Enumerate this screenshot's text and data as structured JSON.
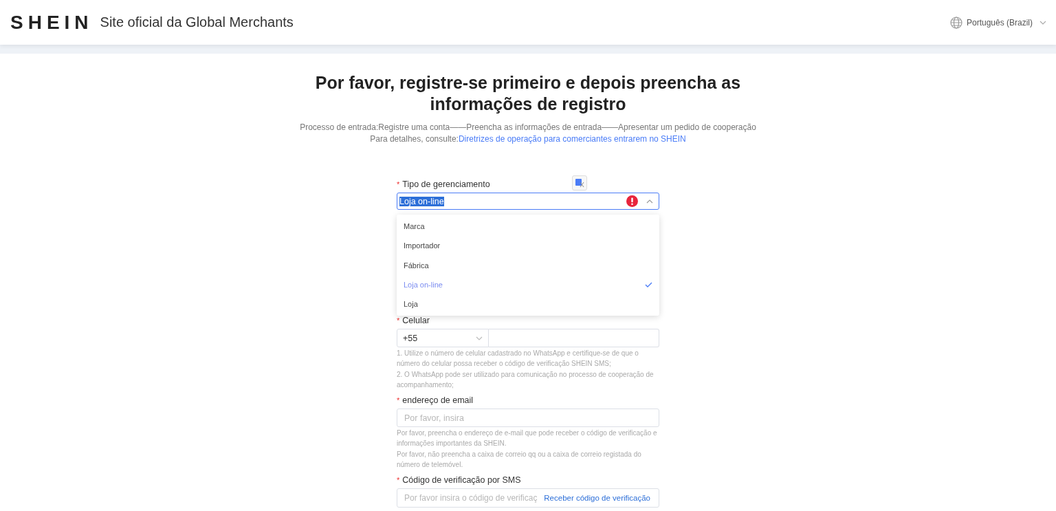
{
  "header": {
    "logo": "SHEIN",
    "subtitle": "Site oficial da Global Merchants",
    "language": "Português (Brazil)"
  },
  "intro": {
    "title": "Por favor, registre-se primeiro e depois preencha as informações de registro",
    "process": "Processo de entrada:Registre uma conta——Preencha as informações de entrada——Apresentar um pedido de cooperação",
    "details_prefix": "Para detalhes, consulte:",
    "details_link": "Diretrizes de operação para comerciantes entrarem no SHEIN"
  },
  "fields": [
    {
      "kind": "select",
      "label": "Tipo de gerenciamento",
      "marker": "*",
      "value": "Loja on-line",
      "error": true,
      "expanded": true,
      "options": [
        {
          "label": "Marca",
          "selected": false
        },
        {
          "label": "Importador",
          "selected": false
        },
        {
          "label": "Fábrica",
          "selected": false
        },
        {
          "label": "Loja on-line",
          "selected": true
        },
        {
          "label": "Loja",
          "selected": false
        }
      ]
    },
    {
      "kind": "phone",
      "label": "Celular",
      "marker": "*",
      "code": "+55",
      "hints": [
        "1. Utilize o número de celular cadastrado no WhatsApp e certifique-se de que o número do celular possa receber o código de verificação SHEIN SMS;",
        "2. O WhatsApp pode ser utilizado para comunicação no processo de cooperação de acompanhamento;"
      ]
    },
    {
      "kind": "email",
      "label": "endereço de email",
      "marker": "*",
      "placeholder": "Por favor, insira",
      "hints": [
        "Por favor, preencha o endereço de e-mail que pode receber o código de verificação e informações importantes da SHEIN.",
        "Por favor, não preencha a caixa de correio qq ou a caixa de correio registada do número de telemóvel."
      ]
    },
    {
      "kind": "sms",
      "label": "Código de verificação por SMS",
      "marker": "*",
      "placeholder": "Por favor insira o código de verificaç",
      "action": "Receber código de verificação"
    }
  ]
}
